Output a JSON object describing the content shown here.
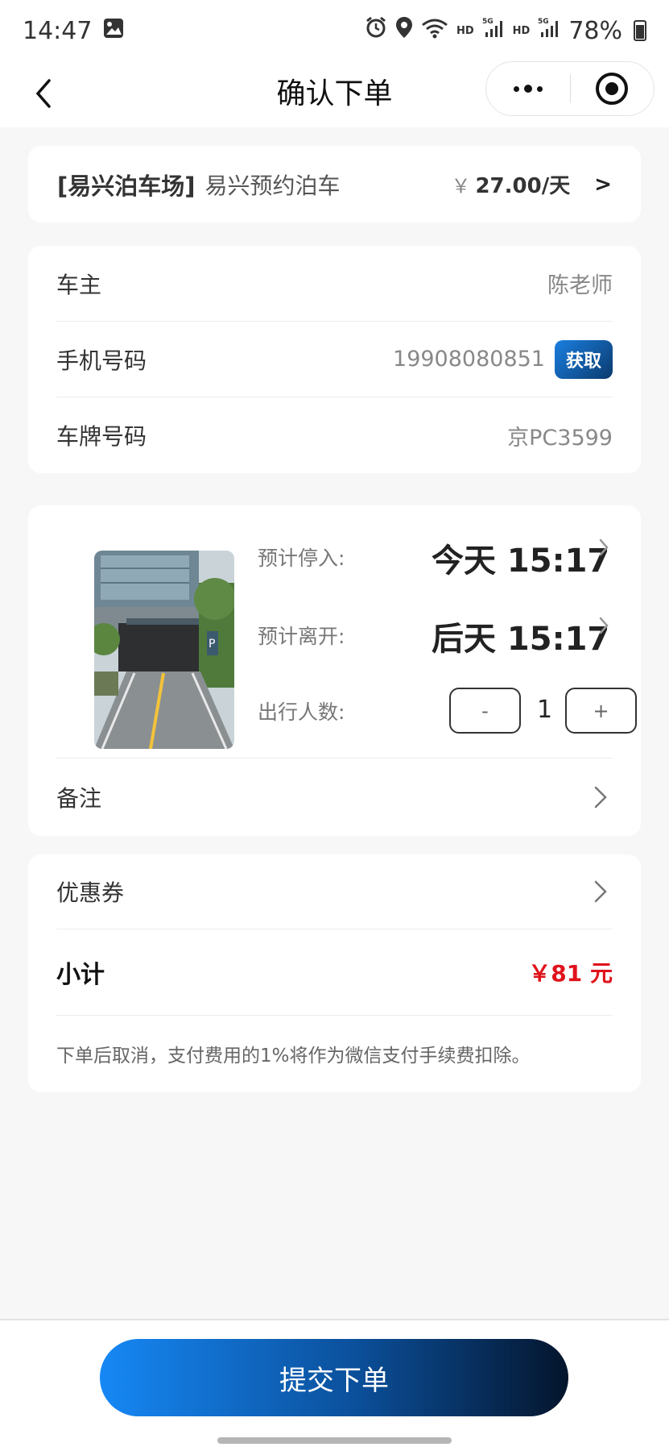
{
  "status_bar": {
    "time": "14:47",
    "network_1": "HD",
    "network_1_gen": "5G",
    "network_2": "HD",
    "network_2_gen": "5G",
    "battery": "78%"
  },
  "header": {
    "title": "确认下单"
  },
  "lot": {
    "name": "[易兴泊车场]",
    "subtitle": "易兴预约泊车",
    "currency": "￥",
    "price": "27.00/天",
    "arrow": ">"
  },
  "info": {
    "owner_label": "车主",
    "owner_value": "陈老师",
    "phone_label": "手机号码",
    "phone_value": "19908080851",
    "fetch_label": "获取",
    "plate_label": "车牌号码",
    "plate_value": "京PC3599"
  },
  "booking": {
    "enter_label": "预计停入:",
    "enter_time": "今天 15:17",
    "leave_label": "预计离开:",
    "leave_time": "后天 15:17",
    "people_label": "出行人数:",
    "minus": "-",
    "people_count": "1",
    "plus": "+",
    "remark_label": "备注"
  },
  "summary": {
    "coupon_label": "优惠券",
    "subtotal_label": "小计",
    "subtotal_value": "￥81 元",
    "note": "下单后取消，支付费用的1%将作为微信支付手续费扣除。"
  },
  "footer": {
    "submit_label": "提交下单"
  },
  "colors": {
    "accent_blue": "#1688f5",
    "accent_dark": "#04152c",
    "price_red": "#e0121a",
    "background": "#f7f7f7"
  }
}
